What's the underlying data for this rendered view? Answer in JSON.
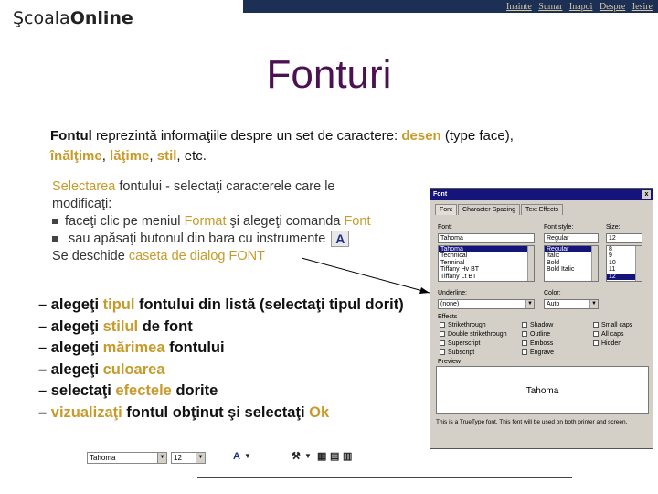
{
  "header": {
    "logo_part1": "Şcoala",
    "logo_part2": "Online",
    "nav": [
      "Inainte",
      "Sumar",
      "Inapoi",
      "Despre",
      "Iesire"
    ]
  },
  "title": "Fonturi",
  "intro": {
    "w1": "Fontul",
    "t1": " reprezintă informaţiile despre un set de caractere: ",
    "w2": "desen",
    "t2": " (type face),",
    "w3": "înălţime",
    "t3": ", ",
    "w4": "lăţime",
    "t4": ", ",
    "w5": "stil",
    "t5": ",  etc."
  },
  "steps1": {
    "l1a": "Selectarea",
    "l1b": " fontului - selectaţi caracterele care le",
    "l1c": "modificaţi:",
    "l2a": "faceţi clic pe meniul ",
    "l2b": "Format",
    "l2c": " şi alegeţi comanda ",
    "l2d": "Font",
    "l3a": " sau apăsaţi butonul  din bara cu instrumente",
    "l3icon": "A",
    "l4a": "Se deschide ",
    "l4b": "caseta de dialog FONT"
  },
  "steps2": {
    "s1a": "– alegeţi ",
    "s1b": "tipul",
    "s1c": " fontului din listă (selectaţi tipul dorit)",
    "s2a": "– alegeţi ",
    "s2b": "stilul",
    "s2c": " de font",
    "s3a": "– alegeţi ",
    "s3b": "mărimea",
    "s3c": " fontului",
    "s4a": "– alegeţi ",
    "s4b": "culoarea",
    "s5a": "– selectaţi ",
    "s5b": "efectele",
    "s5c": " dorite",
    "s6a": "– ",
    "s6b": "vizualizaţi",
    "s6c": " fontul obţinut şi selectaţi ",
    "s6d": "Ok"
  },
  "dialog": {
    "title": "Font",
    "close": "x",
    "tabs": [
      "Font",
      "Character Spacing",
      "Text Effects"
    ],
    "font_label": "Font:",
    "font_value": "Tahoma",
    "font_list": [
      "Tahoma",
      "Technical",
      "Terminal",
      "Tiffany Hv BT",
      "Tiffany Lt BT"
    ],
    "style_label": "Font style:",
    "style_value": "Regular",
    "style_list": [
      "Regular",
      "Italic",
      "Bold",
      "Bold Italic"
    ],
    "size_label": "Size:",
    "size_value": "12",
    "size_list": [
      "8",
      "9",
      "10",
      "11",
      "12"
    ],
    "underline_label": "Underline:",
    "underline_value": "(none)",
    "color_label": "Color:",
    "color_value": "Auto",
    "effects_label": "Effects",
    "effects_col1": [
      "Strikethrough",
      "Double strikethrough",
      "Superscript",
      "Subscript"
    ],
    "effects_col2": [
      "Shadow",
      "Outline",
      "Emboss",
      "Engrave"
    ],
    "effects_col3": [
      "Small caps",
      "All caps",
      "Hidden"
    ],
    "preview_label": "Preview",
    "preview_text": "Tahoma",
    "note": "This is a TrueType font. This font will be used on both printer and screen."
  },
  "toolbar": {
    "font_value": "Tahoma",
    "size_value": "12",
    "color_icon": "A",
    "tools_icon": "tools-icon"
  }
}
